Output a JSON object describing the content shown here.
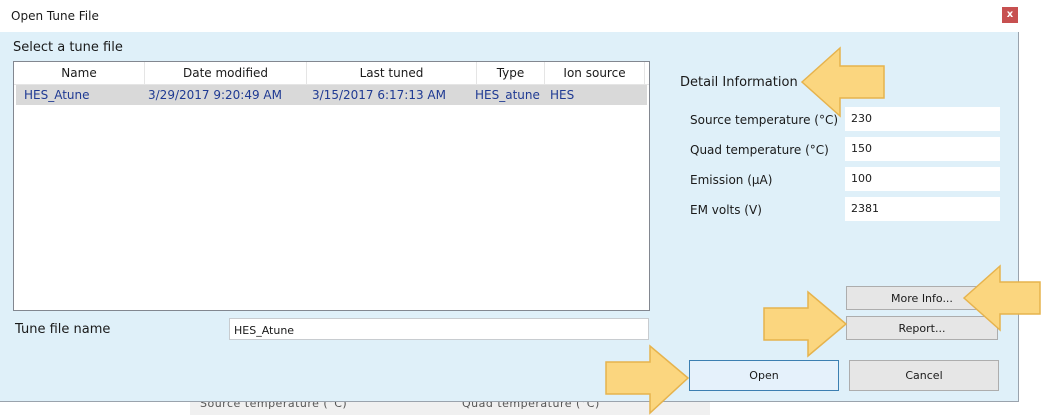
{
  "window": {
    "title": "Open Tune File",
    "close_glyph": "x"
  },
  "list": {
    "section_label": "Select a tune file",
    "columns": [
      "Name",
      "Date modified",
      "Last tuned",
      "Type",
      "Ion source"
    ],
    "rows": [
      {
        "name": "HES_Atune",
        "date_modified": "3/29/2017 9:20:49 AM",
        "last_tuned": "3/15/2017 6:17:13 AM",
        "type": "HES_atune",
        "ion_source": "HES"
      }
    ]
  },
  "tune_file": {
    "label": "Tune file name",
    "value": "HES_Atune"
  },
  "detail": {
    "title": "Detail Information",
    "fields": [
      {
        "label": "Source temperature (°C)",
        "value": "230"
      },
      {
        "label": "Quad temperature (°C)",
        "value": "150"
      },
      {
        "label": "Emission (µA)",
        "value": "100"
      },
      {
        "label": "EM volts (V)",
        "value": "2381"
      }
    ]
  },
  "buttons": {
    "more_info": "More Info...",
    "report": "Report...",
    "open": "Open",
    "cancel": "Cancel"
  },
  "background_text": {
    "left": "Source temperature (°C)",
    "right": "Quad temperature (°C)"
  },
  "colors": {
    "panel_bg": "#dff0f9",
    "selected_row": "#d9d9d9",
    "row_text": "#1f3a93",
    "arrow_fill": "#fbd67f",
    "arrow_stroke": "#e6b34d",
    "open_border": "#3c7fb1"
  }
}
